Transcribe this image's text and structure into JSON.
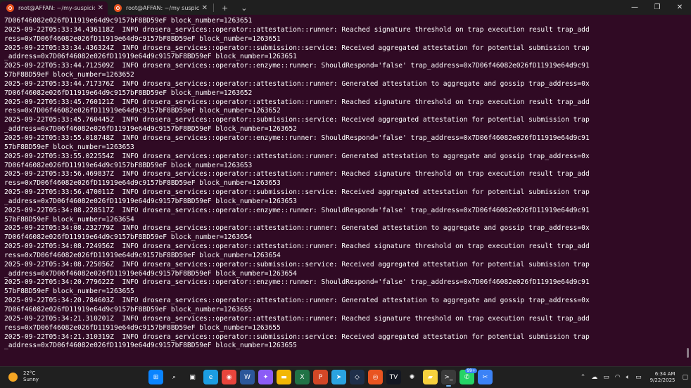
{
  "tabs": [
    {
      "title": "root@AFFAN: ~/my-suspiciou",
      "active": true
    },
    {
      "title": "root@AFFAN: ~/my suspiciou",
      "active": false
    }
  ],
  "tabbar": {
    "close": "✕",
    "new_tab": "+",
    "dropdown": "⌄"
  },
  "window": {
    "minimize": "—",
    "maximize": "❐",
    "close": "✕"
  },
  "terminal": {
    "lines": [
      "7D06f46082e026fD11919e64d9c9157bF8BD59eF block_number=1263651",
      "2025-09-22T05:33:34.436118Z  INFO drosera_services::operator::attestation::runner: Reached signature threshold on trap execution result trap_add",
      "ress=0x7D06f46082e026fD11919e64d9c9157bF8BD59eF block_number=1263651",
      "2025-09-22T05:33:34.436324Z  INFO drosera_services::operator::submission::service: Received aggregated attestation for potential submission trap",
      "_address=0x7D06f46082e026fD11919e64d9c9157bF8BD59eF block_number=1263651",
      "2025-09-22T05:33:44.712509Z  INFO drosera_services::operator::enzyme::runner: ShouldRespond='false' trap_address=0x7D06f46082e026fD11919e64d9c91",
      "57bF8BD59eF block_number=1263652",
      "2025-09-22T05:33:44.717376Z  INFO drosera_services::operator::attestation::runner: Generated attestation to aggregate and gossip trap_address=0x",
      "7D06f46082e026fD11919e64d9c9157bF8BD59eF block_number=1263652",
      "2025-09-22T05:33:45.760121Z  INFO drosera_services::operator::attestation::runner: Reached signature threshold on trap execution result trap_add",
      "ress=0x7D06f46082e026fD11919e64d9c9157bF8BD59eF block_number=1263652",
      "2025-09-22T05:33:45.760445Z  INFO drosera_services::operator::submission::service: Received aggregated attestation for potential submission trap",
      "_address=0x7D06f46082e026fD11919e64d9c9157bF8BD59eF block_number=1263652",
      "2025-09-22T05:33:55.018748Z  INFO drosera_services::operator::enzyme::runner: ShouldRespond='false' trap_address=0x7D06f46082e026fD11919e64d9c91",
      "57bF8BD59eF block_number=1263653",
      "2025-09-22T05:33:55.022554Z  INFO drosera_services::operator::attestation::runner: Generated attestation to aggregate and gossip trap_address=0x",
      "7D06f46082e026fD11919e64d9c9157bF8BD59eF block_number=1263653",
      "2025-09-22T05:33:56.469837Z  INFO drosera_services::operator::attestation::runner: Reached signature threshold on trap execution result trap_add",
      "ress=0x7D06f46082e026fD11919e64d9c9157bF8BD59eF block_number=1263653",
      "2025-09-22T05:33:56.470011Z  INFO drosera_services::operator::submission::service: Received aggregated attestation for potential submission trap",
      "_address=0x7D06f46082e026fD11919e64d9c9157bF8BD59eF block_number=1263653",
      "2025-09-22T05:34:08.228517Z  INFO drosera_services::operator::enzyme::runner: ShouldRespond='false' trap_address=0x7D06f46082e026fD11919e64d9c91",
      "57bF8BD59eF block_number=1263654",
      "2025-09-22T05:34:08.232779Z  INFO drosera_services::operator::attestation::runner: Generated attestation to aggregate and gossip trap_address=0x",
      "7D06f46082e026fD11919e64d9c9157bF8BD59eF block_number=1263654",
      "2025-09-22T05:34:08.724956Z  INFO drosera_services::operator::attestation::runner: Reached signature threshold on trap execution result trap_add",
      "ress=0x7D06f46082e026fD11919e64d9c9157bF8BD59eF block_number=1263654",
      "2025-09-22T05:34:08.725056Z  INFO drosera_services::operator::submission::service: Received aggregated attestation for potential submission trap",
      "_address=0x7D06f46082e026fD11919e64d9c9157bF8BD59eF block_number=1263654",
      "2025-09-22T05:34:20.779622Z  INFO drosera_services::operator::enzyme::runner: ShouldRespond='false' trap_address=0x7D06f46082e026fD11919e64d9c91",
      "57bF8BD59eF block_number=1263655",
      "2025-09-22T05:34:20.784603Z  INFO drosera_services::operator::attestation::runner: Generated attestation to aggregate and gossip trap_address=0x",
      "7D06f46082e026fD11919e64d9c9157bF8BD59eF block_number=1263655",
      "2025-09-22T05:34:21.310201Z  INFO drosera_services::operator::attestation::runner: Reached signature threshold on trap execution result trap_add",
      "ress=0x7D06f46082e026fD11919e64d9c9157bF8BD59eF block_number=1263655",
      "2025-09-22T05:34:21.310319Z  INFO drosera_services::operator::submission::service: Received aggregated attestation for potential submission trap",
      "_address=0x7D06f46082e026fD11919e64d9c9157bF8BD59eF block_number=1263655"
    ]
  },
  "weather": {
    "temp": "22°C",
    "condition": "Sunny"
  },
  "taskbar": {
    "apps": [
      {
        "name": "start-icon",
        "color": "#0a84ff",
        "glyph": "⊞"
      },
      {
        "name": "search-icon",
        "color": "transparent",
        "glyph": "⌕"
      },
      {
        "name": "task-view-icon",
        "color": "transparent",
        "glyph": "▣"
      },
      {
        "name": "edge-icon",
        "color": "#1b9de2",
        "glyph": "e"
      },
      {
        "name": "chrome-icon",
        "color": "#e8453c",
        "glyph": "◉"
      },
      {
        "name": "word-icon",
        "color": "#2b579a",
        "glyph": "W"
      },
      {
        "name": "copilot-icon",
        "color": "#8b5cf6",
        "glyph": "✦"
      },
      {
        "name": "file-explorer-icon",
        "color": "#f2b705",
        "glyph": "▬"
      },
      {
        "name": "excel-icon",
        "color": "#217346",
        "glyph": "X"
      },
      {
        "name": "powerpoint-icon",
        "color": "#d24726",
        "glyph": "P"
      },
      {
        "name": "telegram-icon",
        "color": "#2aa3e0",
        "glyph": "➤"
      },
      {
        "name": "vscode-icon",
        "color": "#1f2f4a",
        "glyph": "◇"
      },
      {
        "name": "ubuntu-icon",
        "color": "#e95420",
        "glyph": "◎"
      },
      {
        "name": "tradingview-icon",
        "color": "#131722",
        "glyph": "TV"
      },
      {
        "name": "chatgpt-icon",
        "color": "transparent",
        "glyph": "✺"
      },
      {
        "name": "sticky-notes-icon",
        "color": "#f7d13d",
        "glyph": "▰"
      },
      {
        "name": "terminal-icon",
        "color": "#3a3a3a",
        "glyph": ">_"
      },
      {
        "name": "whatsapp-icon",
        "color": "#25d366",
        "glyph": "✆"
      },
      {
        "name": "snipping-tool-icon",
        "color": "#3b82f6",
        "glyph": "✂"
      }
    ],
    "whatsapp_badge": "99+"
  },
  "tray": {
    "chevron": "⌃",
    "clock": "6:34 AM",
    "date": "9/22/2025"
  }
}
